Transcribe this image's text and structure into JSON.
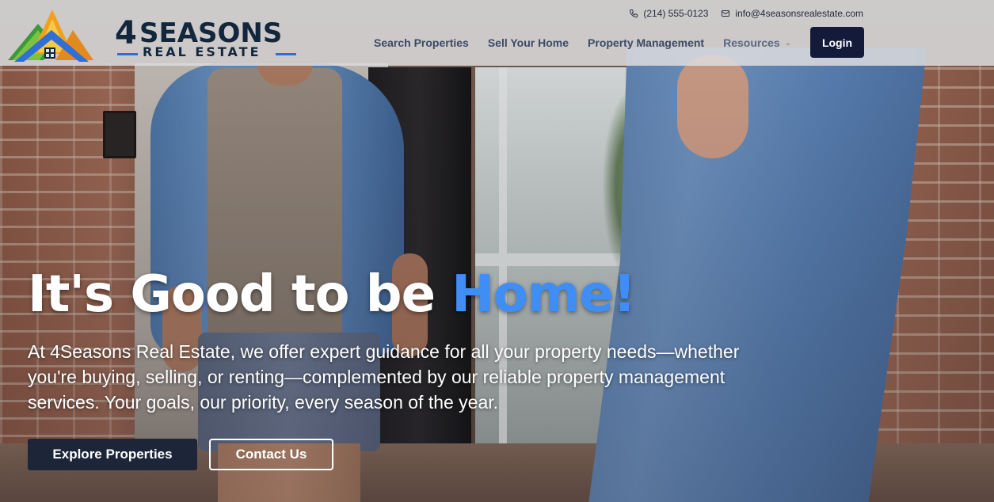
{
  "header": {
    "logo": {
      "number": "4",
      "title": "SEASONS",
      "subtitle": "REAL ESTATE",
      "icon": "house-mountains-logo"
    },
    "contact": {
      "phone_icon": "phone-icon",
      "phone": "(214) 555-0123",
      "email_icon": "mail-icon",
      "email": "info@4seasonsrealestate.com"
    },
    "nav": {
      "items": [
        {
          "label": "Search Properties"
        },
        {
          "label": "Sell Your Home"
        },
        {
          "label": "Property Management"
        },
        {
          "label": "Resources",
          "has_dropdown": true
        }
      ],
      "login_label": "Login"
    }
  },
  "hero": {
    "headline_prefix": "It's Good to be ",
    "headline_accent": "Home!",
    "description": "At 4Seasons Real Estate, we offer expert guidance for all your property needs—whether you're buying, selling, or renting—complemented by our reliable property management services. Your goals, our priority, every season of the year.",
    "primary_button": "Explore Properties",
    "secondary_button": "Contact Us"
  },
  "colors": {
    "accent": "#3f8ef5",
    "navy": "#131a3a",
    "nav_text": "#3a4a66"
  }
}
